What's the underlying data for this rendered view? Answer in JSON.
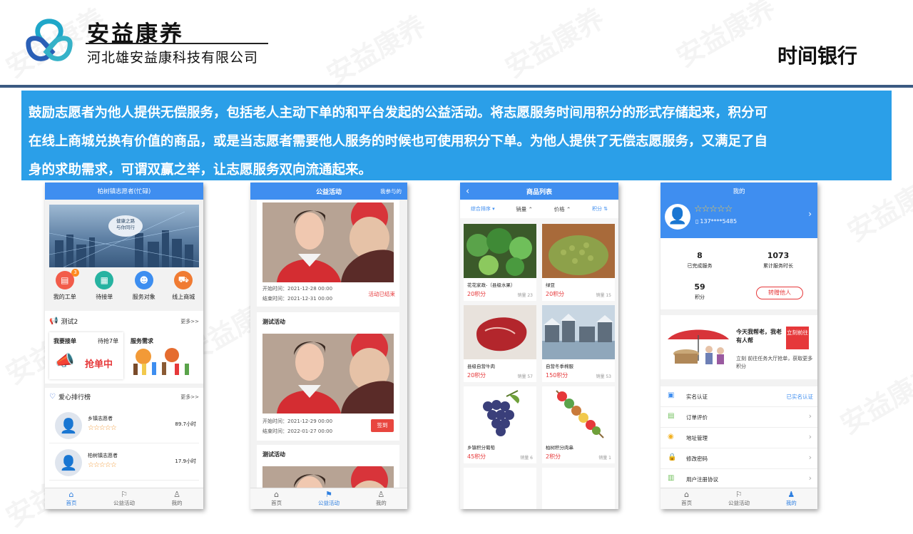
{
  "header": {
    "brand_name": "安益康养",
    "brand_sub": "河北雄安益康科技有限公司",
    "page_title": "时间银行",
    "watermark": "安益康养"
  },
  "intro": {
    "lines": [
      "鼓励志愿者为他人提供无偿服务，包括老人主动下单的和平台发起的公益活动。将志愿服务时间用积分的形式存储起来，积分可",
      "在线上商城兑换有价值的商品，或是当志愿者需要他人服务的时候也可使用积分下单。为他人提供了无偿志愿服务，又满足了自",
      "身的求助需求，可谓双赢之举，让志愿服务双向流通起来。"
    ]
  },
  "colors": {
    "accent": "#3f8ef0",
    "intro_bg": "#2b9fe8",
    "red": "#e6383a",
    "orange": "#f29a37"
  },
  "tabs": [
    "首页",
    "公益活动",
    "我的"
  ],
  "phone1": {
    "title": "柏树镇志愿者(忙碌)",
    "banner_text": [
      "健康之路",
      "与你同行"
    ],
    "quick": [
      {
        "label": "我的工单",
        "badge": "3",
        "icon": "clipboard-icon",
        "color": "#f25c4a"
      },
      {
        "label": "待接单",
        "badge": "",
        "icon": "document-icon",
        "color": "#27b3a1"
      },
      {
        "label": "服务对象",
        "badge": "",
        "icon": "people-icon",
        "color": "#3d8ef0"
      },
      {
        "label": "线上商城",
        "badge": "",
        "icon": "cart-icon",
        "color": "#f07b33"
      }
    ],
    "notice": "测试2",
    "more": "更多>>",
    "take": {
      "title": "我要接单",
      "pending": "待抢7单",
      "grab": "抢单中"
    },
    "need": {
      "title": "服务需求"
    },
    "rank": {
      "title": "爱心排行榜",
      "more": "更多>>",
      "items": [
        {
          "name": "乡镇志愿者",
          "hours": "89.7小时",
          "stars": "☆☆☆☆☆"
        },
        {
          "name": "柏树镇志愿者",
          "hours": "17.9小时",
          "stars": "☆☆☆☆☆"
        }
      ]
    }
  },
  "phone2": {
    "title": "公益活动",
    "right": "我参与的",
    "items": [
      {
        "title": "",
        "start": "开始时间：2021-12-28 00:00",
        "end": "结束时间：2021-12-31 00:00",
        "status": "活动已结束",
        "status_type": "text"
      },
      {
        "title": "测试活动",
        "start": "开始时间：2021-12-29 00:00",
        "end": "结束时间：2022-01-27 00:00",
        "status": "签到",
        "status_type": "button"
      },
      {
        "title": "测试活动",
        "start": "",
        "end": "",
        "status": "",
        "status_type": "none"
      }
    ]
  },
  "phone3": {
    "title": "商品列表",
    "filters": [
      "综合排序 ▾",
      "销量 ⌃",
      "价格 ⌃",
      "积分 ⇅"
    ],
    "products": [
      {
        "name": "花花家政-（县级水果）",
        "price": "20积分",
        "sold": "销量 23",
        "img": "greens"
      },
      {
        "name": "绿豆",
        "price": "20积分",
        "sold": "销量 15",
        "img": "beans"
      },
      {
        "name": "县级自营牛肉",
        "price": "20积分",
        "sold": "销量 57",
        "img": "beef"
      },
      {
        "name": "自营冬季棉服",
        "price": "150积分",
        "sold": "销量 53",
        "img": "town"
      },
      {
        "name": "乡镇积分葡萄",
        "price": "45积分",
        "sold": "销量 6",
        "img": "grape"
      },
      {
        "name": "柏树积分肉串",
        "price": "2积分",
        "sold": "销量 1",
        "img": "skewer"
      }
    ]
  },
  "phone4": {
    "title": "我的",
    "phone": "137****5485",
    "stars": "☆☆☆☆☆",
    "stats": [
      {
        "value": "8",
        "label": "已完成服务"
      },
      {
        "value": "1073",
        "label": "累计服务时长"
      },
      {
        "value": "59",
        "label": "积分"
      }
    ],
    "gift_btn": "转赠他人",
    "promo": {
      "title": "今天我帮老，我老有人帮",
      "btn": "立刻前往",
      "desc": "立刻 前往任务大厅抢单，获取更多积分"
    },
    "menu": [
      {
        "label": "实名认证",
        "right": "已实名认证",
        "icon": "id-card-icon"
      },
      {
        "label": "订单评价",
        "right": "",
        "icon": "note-icon"
      },
      {
        "label": "地址管理",
        "right": "",
        "icon": "location-icon"
      },
      {
        "label": "修改密码",
        "right": "",
        "icon": "lock-icon"
      },
      {
        "label": "用户注册协议",
        "right": "",
        "icon": "doc-icon"
      }
    ]
  }
}
